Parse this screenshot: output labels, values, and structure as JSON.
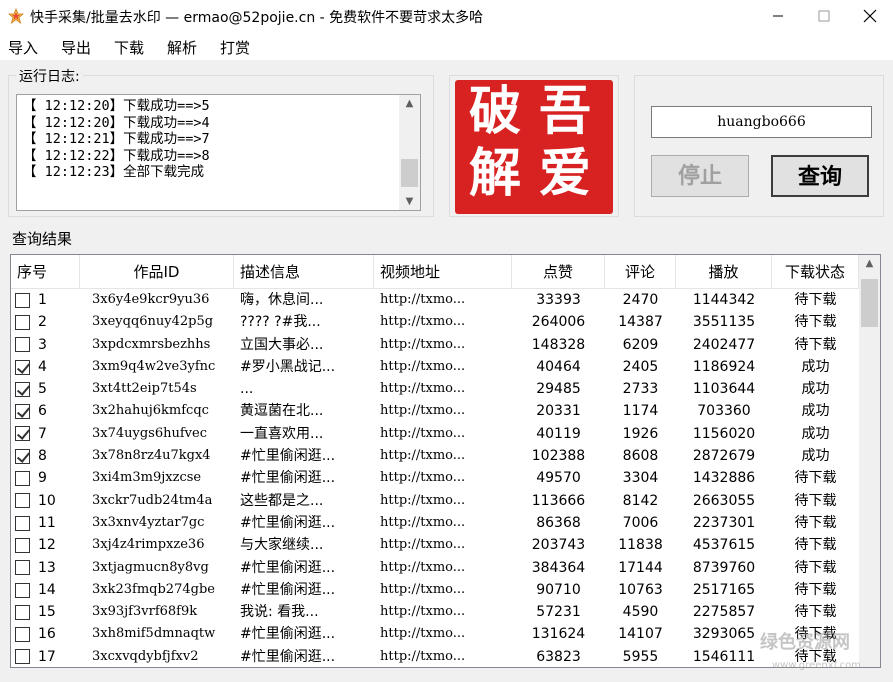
{
  "window": {
    "title": "快手采集/批量去水印 — ermao@52pojie.cn -  免费软件不要苛求太多哈",
    "minimize": "—",
    "maximize": "☐",
    "close": "✕"
  },
  "menu": [
    "导入",
    "导出",
    "下载",
    "解析",
    "打赏"
  ],
  "log": {
    "caption": "运行日志:",
    "lines": [
      "【 12:12:20】下载成功==>5",
      "【 12:12:20】下载成功==>4",
      "【 12:12:21】下载成功==>7",
      "【 12:12:22】下载成功==>8",
      "【 12:12:23】全部下载完成"
    ]
  },
  "seal": {
    "chars": [
      "吾",
      "爱",
      "破",
      "解"
    ],
    "color": "#d82121"
  },
  "controls": {
    "username": "huangbo666",
    "stop_label": "停止",
    "query_label": "查询"
  },
  "results": {
    "caption": "查询结果",
    "columns": [
      "序号",
      "作品ID",
      "描述信息",
      "视频地址",
      "点赞",
      "评论",
      "播放",
      "下载状态"
    ],
    "rows": [
      {
        "checked": false,
        "no": "1",
        "id": "3x6y4e9kcr9yu36",
        "desc": "嗨，休息间...",
        "url": "http://txmo...",
        "likes": "33393",
        "comments": "2470",
        "plays": "1144342",
        "status": "待下载"
      },
      {
        "checked": false,
        "no": "2",
        "id": "3xeyqq6nuy42p5g",
        "desc": "????  ?#我...",
        "url": "http://txmo...",
        "likes": "264006",
        "comments": "14387",
        "plays": "3551135",
        "status": "待下载"
      },
      {
        "checked": false,
        "no": "3",
        "id": "3xpdcxmrsbezhhs",
        "desc": "立国大事必...",
        "url": "http://txmo...",
        "likes": "148328",
        "comments": "6209",
        "plays": "2402477",
        "status": "待下载"
      },
      {
        "checked": true,
        "no": "4",
        "id": "3xm9q4w2ve3yfnc",
        "desc": "#罗小黑战记...",
        "url": "http://txmo...",
        "likes": "40464",
        "comments": "2405",
        "plays": "1186924",
        "status": "成功"
      },
      {
        "checked": true,
        "no": "5",
        "id": "3xt4tt2eip7t54s",
        "desc": "...",
        "url": "http://txmo...",
        "likes": "29485",
        "comments": "2733",
        "plays": "1103644",
        "status": "成功"
      },
      {
        "checked": true,
        "no": "6",
        "id": "3x2hahuj6kmfcqc",
        "desc": "黄逗菌在北...",
        "url": "http://txmo...",
        "likes": "20331",
        "comments": "1174",
        "plays": "703360",
        "status": "成功"
      },
      {
        "checked": true,
        "no": "7",
        "id": "3x74uygs6hufvec",
        "desc": "一直喜欢用...",
        "url": "http://txmo...",
        "likes": "40119",
        "comments": "1926",
        "plays": "1156020",
        "status": "成功"
      },
      {
        "checked": true,
        "no": "8",
        "id": "3x78n8rz4u7kgx4",
        "desc": "#忙里偷闲逛...",
        "url": "http://txmo...",
        "likes": "102388",
        "comments": "8608",
        "plays": "2872679",
        "status": "成功"
      },
      {
        "checked": false,
        "no": "9",
        "id": "3xi4m3m9jxzcse",
        "desc": "#忙里偷闲逛...",
        "url": "http://txmo...",
        "likes": "49570",
        "comments": "3304",
        "plays": "1432886",
        "status": "待下载"
      },
      {
        "checked": false,
        "no": "10",
        "id": "3xckr7udb24tm4a",
        "desc": "这些都是之...",
        "url": "http://txmo...",
        "likes": "113666",
        "comments": "8142",
        "plays": "2663055",
        "status": "待下载"
      },
      {
        "checked": false,
        "no": "11",
        "id": "3x3xnv4yztar7gc",
        "desc": "#忙里偷闲逛...",
        "url": "http://txmo...",
        "likes": "86368",
        "comments": "7006",
        "plays": "2237301",
        "status": "待下载"
      },
      {
        "checked": false,
        "no": "12",
        "id": "3xj4z4rimpxze36",
        "desc": "与大家继续...",
        "url": "http://txmo...",
        "likes": "203743",
        "comments": "11838",
        "plays": "4537615",
        "status": "待下载"
      },
      {
        "checked": false,
        "no": "13",
        "id": "3xtjagmucn8y8vg",
        "desc": "#忙里偷闲逛...",
        "url": "http://txmo...",
        "likes": "384364",
        "comments": "17144",
        "plays": "8739760",
        "status": "待下载"
      },
      {
        "checked": false,
        "no": "14",
        "id": "3xk23fmqb274gbe",
        "desc": "#忙里偷闲逛...",
        "url": "http://txmo...",
        "likes": "90710",
        "comments": "10763",
        "plays": "2517165",
        "status": "待下载"
      },
      {
        "checked": false,
        "no": "15",
        "id": "3x93jf3vrf68f9k",
        "desc": "我说: 看我...",
        "url": "http://txmo...",
        "likes": "57231",
        "comments": "4590",
        "plays": "2275857",
        "status": "待下载"
      },
      {
        "checked": false,
        "no": "16",
        "id": "3xh8mif5dmnaqtw",
        "desc": "#忙里偷闲逛...",
        "url": "http://txmo...",
        "likes": "131624",
        "comments": "14107",
        "plays": "3293065",
        "status": "待下载"
      },
      {
        "checked": false,
        "no": "17",
        "id": "3xcxvqdybfjfxv2",
        "desc": "#忙里偷闲逛...",
        "url": "http://txmo...",
        "likes": "63823",
        "comments": "5955",
        "plays": "1546111",
        "status": "待下载"
      }
    ]
  },
  "watermark": {
    "text": "绿色资源网",
    "url": "www.greenxf.com"
  }
}
